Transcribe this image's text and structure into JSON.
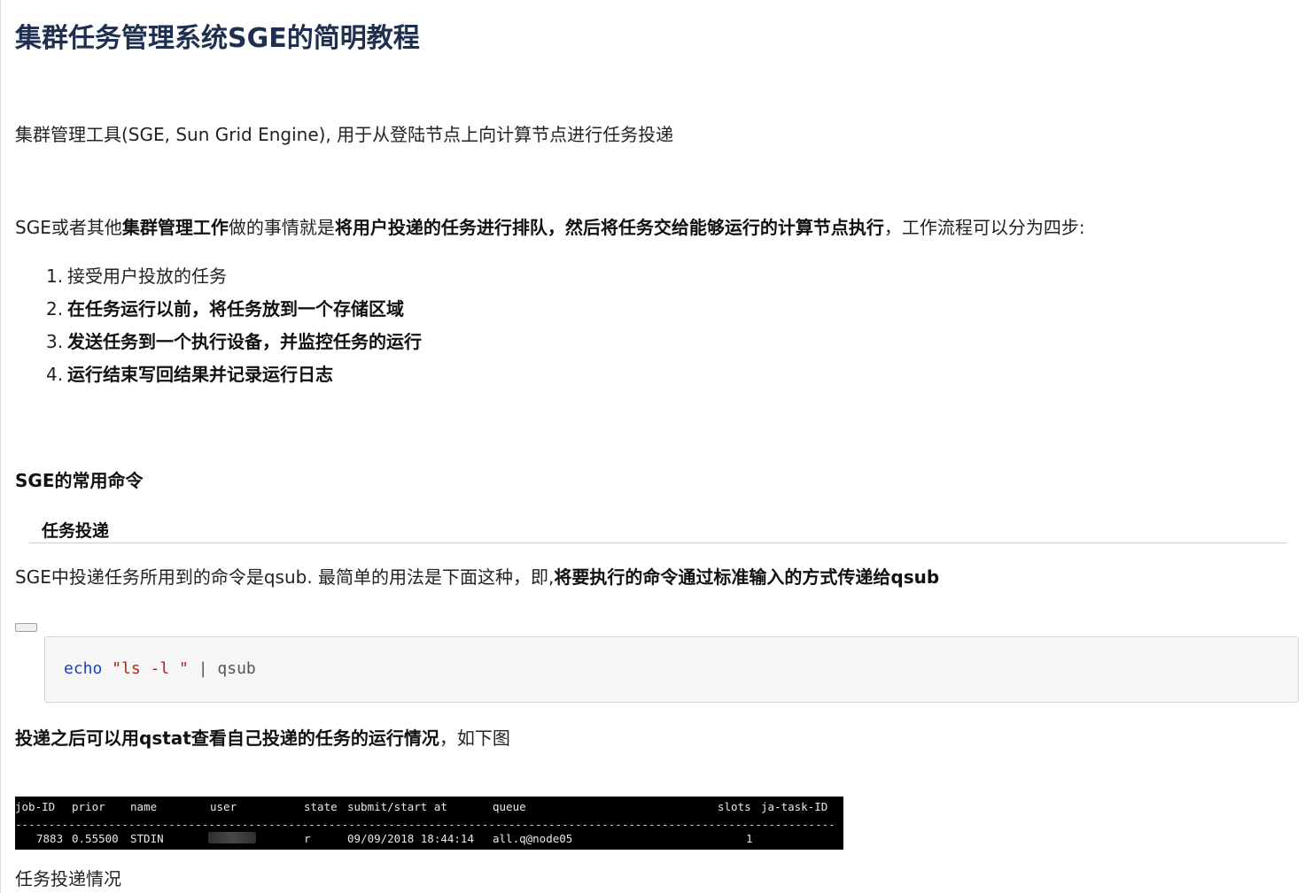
{
  "article": {
    "title": "集群任务管理系统SGE的简明教程",
    "intro": "集群管理工具(SGE, Sun Grid Engine), 用于从登陆节点上向计算节点进行任务投递",
    "para2": {
      "p1": "SGE或者其他",
      "b1": "集群管理工作",
      "p2": "做的事情就是",
      "b2": "将用户投递的任务进行排队，然后将任务交给能够运行的计算节点执行",
      "p3": "，工作流程可以分为四步:"
    },
    "steps": [
      {
        "num": "1.",
        "text": "接受用户投放的任务"
      },
      {
        "num": "2.",
        "text": "在任务运行以前，将任务放到一个存储区域"
      },
      {
        "num": "3.",
        "text": "发送任务到一个执行设备，并监控任务的运行"
      },
      {
        "num": "4.",
        "text": "运行结束写回结果并记录运行日志"
      }
    ],
    "section_heading": "SGE的常用命令",
    "subsection_heading": "任务投递",
    "para3": {
      "p1": "SGE中投递任务所用到的命令是qsub. 最简单的用法是下面这种，即,",
      "b1": "将要执行的命令通过标准输入的方式传递给qsub"
    },
    "code": {
      "keyword": "echo",
      "string": " \"ls -l \"",
      "rest": " | qsub"
    },
    "para4": {
      "b1": "投递之后可以用qstat查看自己投递的任务的运行情况",
      "p1": "，如下图"
    },
    "terminal": {
      "headers": [
        "job-ID",
        "prior",
        "name",
        "user",
        "state",
        "submit/start at",
        "queue",
        "slots",
        "ja-task-ID"
      ],
      "divider": "---------------------------------------------------------------------------------------------------------------------------",
      "row": {
        "job_id": "7883",
        "prior": "0.55500",
        "name": "STDIN",
        "state": "r",
        "submit": "09/09/2018 18:44:14",
        "queue": "all.q@node05",
        "slots": "1"
      }
    },
    "caption": "任务投递情况"
  }
}
